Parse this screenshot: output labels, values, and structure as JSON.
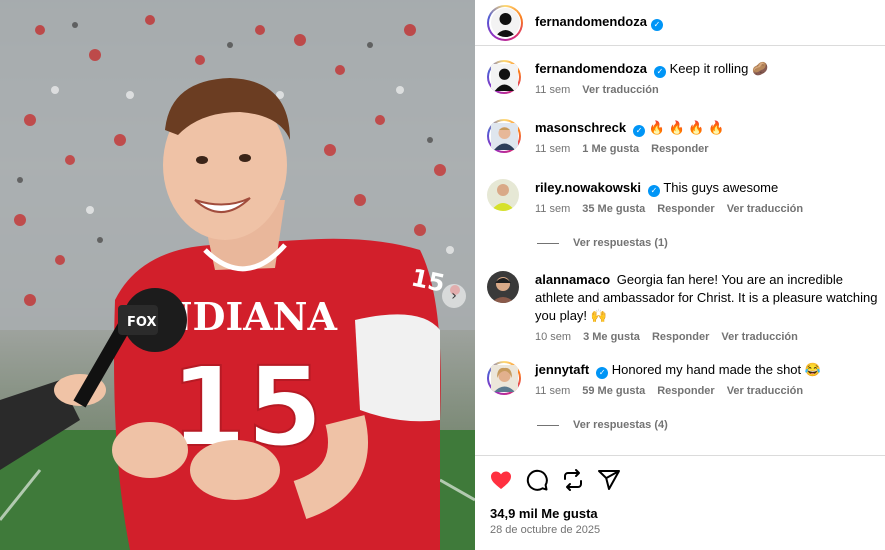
{
  "post": {
    "author": "fernandomendoza",
    "next_glyph": "›"
  },
  "photo": {
    "jersey_text": "INDIANA",
    "jersey_number": "15",
    "sleeve_number": "15",
    "mic_label": "FOX"
  },
  "comments": [
    {
      "user": "fernandomendoza",
      "text": "Keep it rolling 🥔",
      "time": "11 sem",
      "likes": "",
      "reply": "",
      "translate": "Ver traducción"
    },
    {
      "user": "masonschreck",
      "text": "🔥 🔥 🔥 🔥",
      "time": "11 sem",
      "likes": "1 Me gusta",
      "reply": "Responder",
      "translate": ""
    },
    {
      "user": "riley.nowakowski",
      "text": "This guys awesome",
      "time": "11 sem",
      "likes": "35 Me gusta",
      "reply": "Responder",
      "translate": "Ver traducción",
      "replies_label": "Ver respuestas (1)"
    },
    {
      "user": "alannamaco",
      "text": "Georgia fan here! You are an incredible athlete and ambassador for Christ. It is a pleasure watching you play! 🙌",
      "time": "10 sem",
      "likes": "3 Me gusta",
      "reply": "Responder",
      "translate": "Ver traducción"
    },
    {
      "user": "jennytaft",
      "text": "Honored my hand made the shot 😂",
      "time": "11 sem",
      "likes": "59 Me gusta",
      "reply": "Responder",
      "translate": "Ver traducción",
      "replies_label": "Ver respuestas (4)"
    }
  ],
  "actions": {
    "like_icon": "heart-filled-icon",
    "comment_icon": "comment-icon",
    "repost_icon": "repost-icon",
    "share_icon": "send-icon",
    "like_color": "#ff3040",
    "likes_count": "34,9 mil Me gusta",
    "date": "28 de octubre de 2025"
  },
  "colors": {
    "verified": "#0095f6",
    "muted": "#737373",
    "jersey_red": "#d21f2b"
  }
}
